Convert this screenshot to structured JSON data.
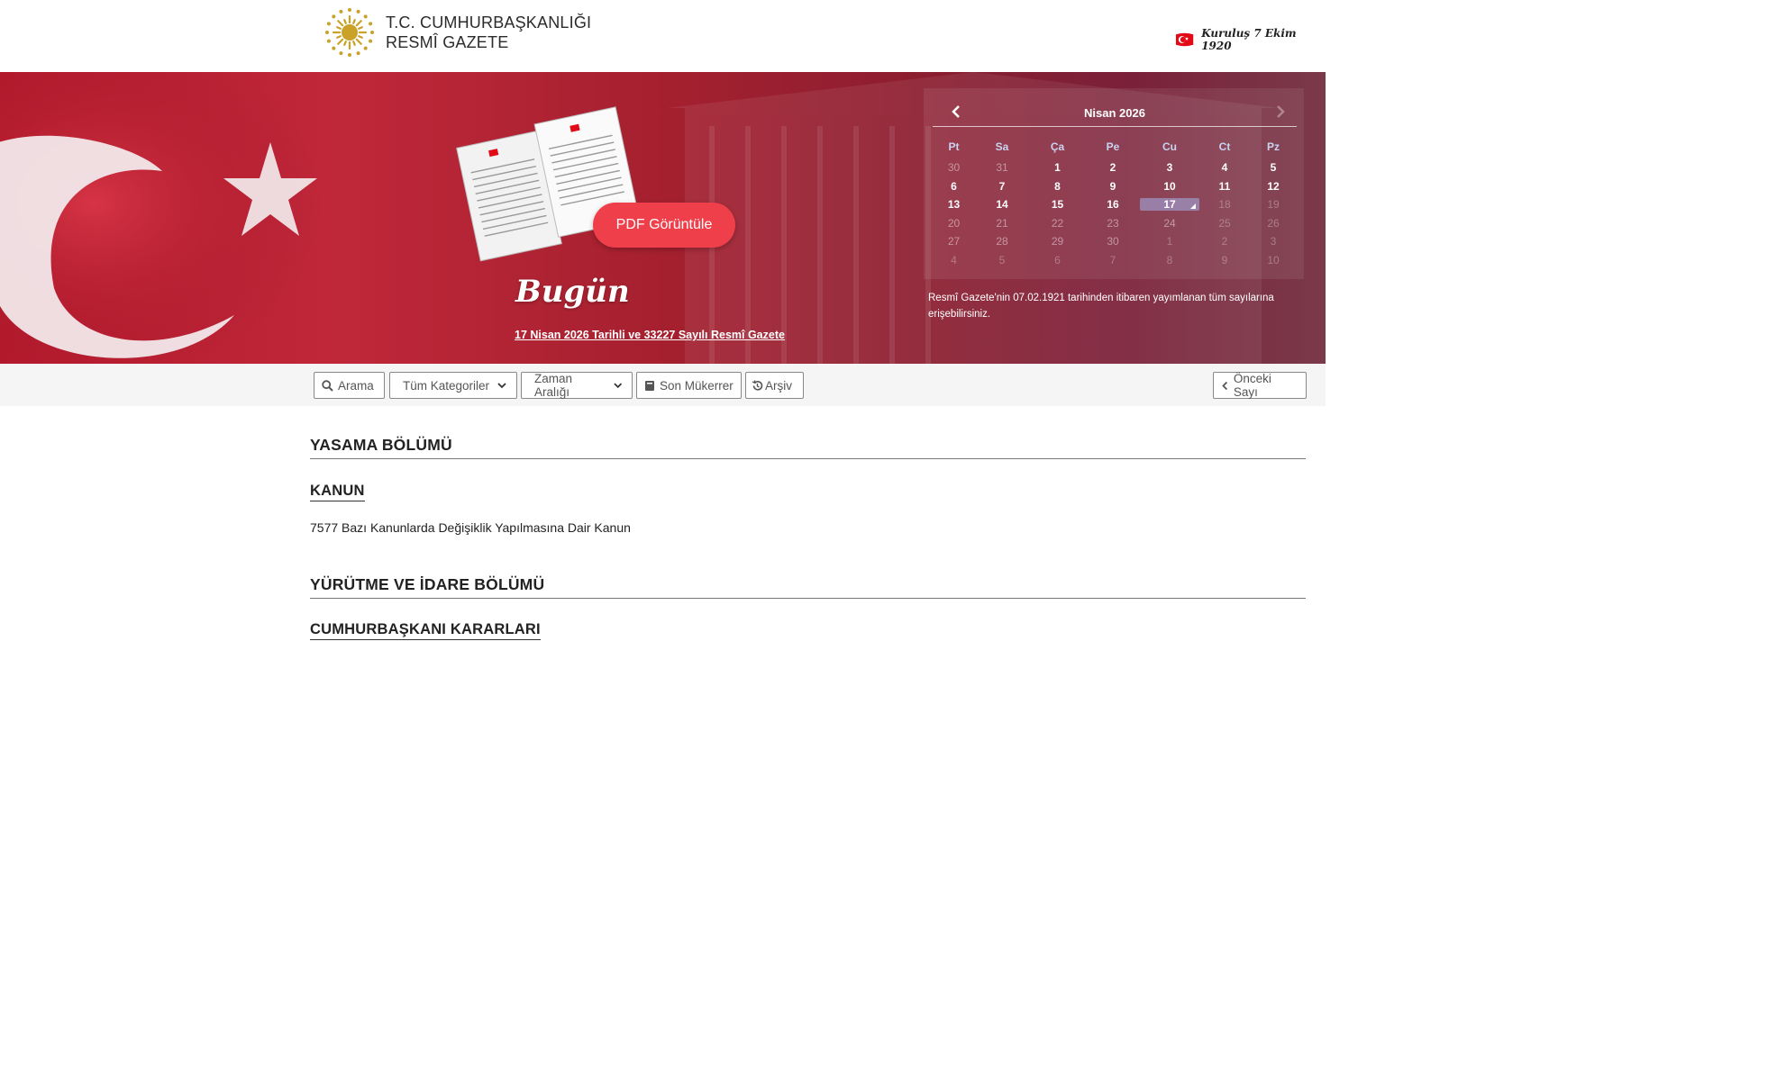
{
  "header": {
    "brand_line1": "T.C. CUMHURBAŞKANLIĞI",
    "brand_line2": "RESMÎ GAZETE",
    "founded": "Kuruluş 7 Ekim 1920"
  },
  "hero": {
    "pdf_button": "PDF Görüntüle",
    "today_title": "Bugün",
    "today_link": "17 Nisan 2026 Tarihli ve 33227 Sayılı Resmî Gazete",
    "calendar": {
      "month": "Nisan 2026",
      "weekdays": [
        "Pt",
        "Sa",
        "Ça",
        "Pe",
        "Cu",
        "Ct",
        "Pz"
      ],
      "weeks": [
        [
          "30",
          "31",
          "1",
          "2",
          "3",
          "4",
          "5"
        ],
        [
          "6",
          "7",
          "8",
          "9",
          "10",
          "11",
          "12"
        ],
        [
          "13",
          "14",
          "15",
          "16",
          "17",
          "18",
          "19"
        ],
        [
          "20",
          "21",
          "22",
          "23",
          "24",
          "25",
          "26"
        ],
        [
          "27",
          "28",
          "29",
          "30",
          "1",
          "2",
          "3"
        ],
        [
          "4",
          "5",
          "6",
          "7",
          "8",
          "9",
          "10"
        ]
      ],
      "selected_day": "17"
    },
    "archive_note": "Resmî Gazete'nin 07.02.1921 tarihinden itibaren yayımlanan tüm sayılarına erişebilirsiniz."
  },
  "toolbar": {
    "search": "Arama",
    "category_select": "Tüm Kategoriler",
    "range_select": "Zaman Aralığı",
    "recent_mukerrer": "Son Mükerrer",
    "archive": "Arşiv",
    "previous_issue": "Önceki Sayı"
  },
  "content": {
    "section1_title": "YASAMA BÖLÜMÜ",
    "section1_sub": "KANUN",
    "section1_item": "7577 Bazı Kanunlarda Değişiklik Yapılmasına Dair Kanun",
    "section2_title": "YÜRÜTME VE İDARE BÖLÜMÜ",
    "section2_sub": "CUMHURBAŞKANI KARARLARI"
  },
  "colors": {
    "hero_red": "#b3192c",
    "pdf_button": "#ef3f4a",
    "emblem_gold": "#c9a227"
  }
}
